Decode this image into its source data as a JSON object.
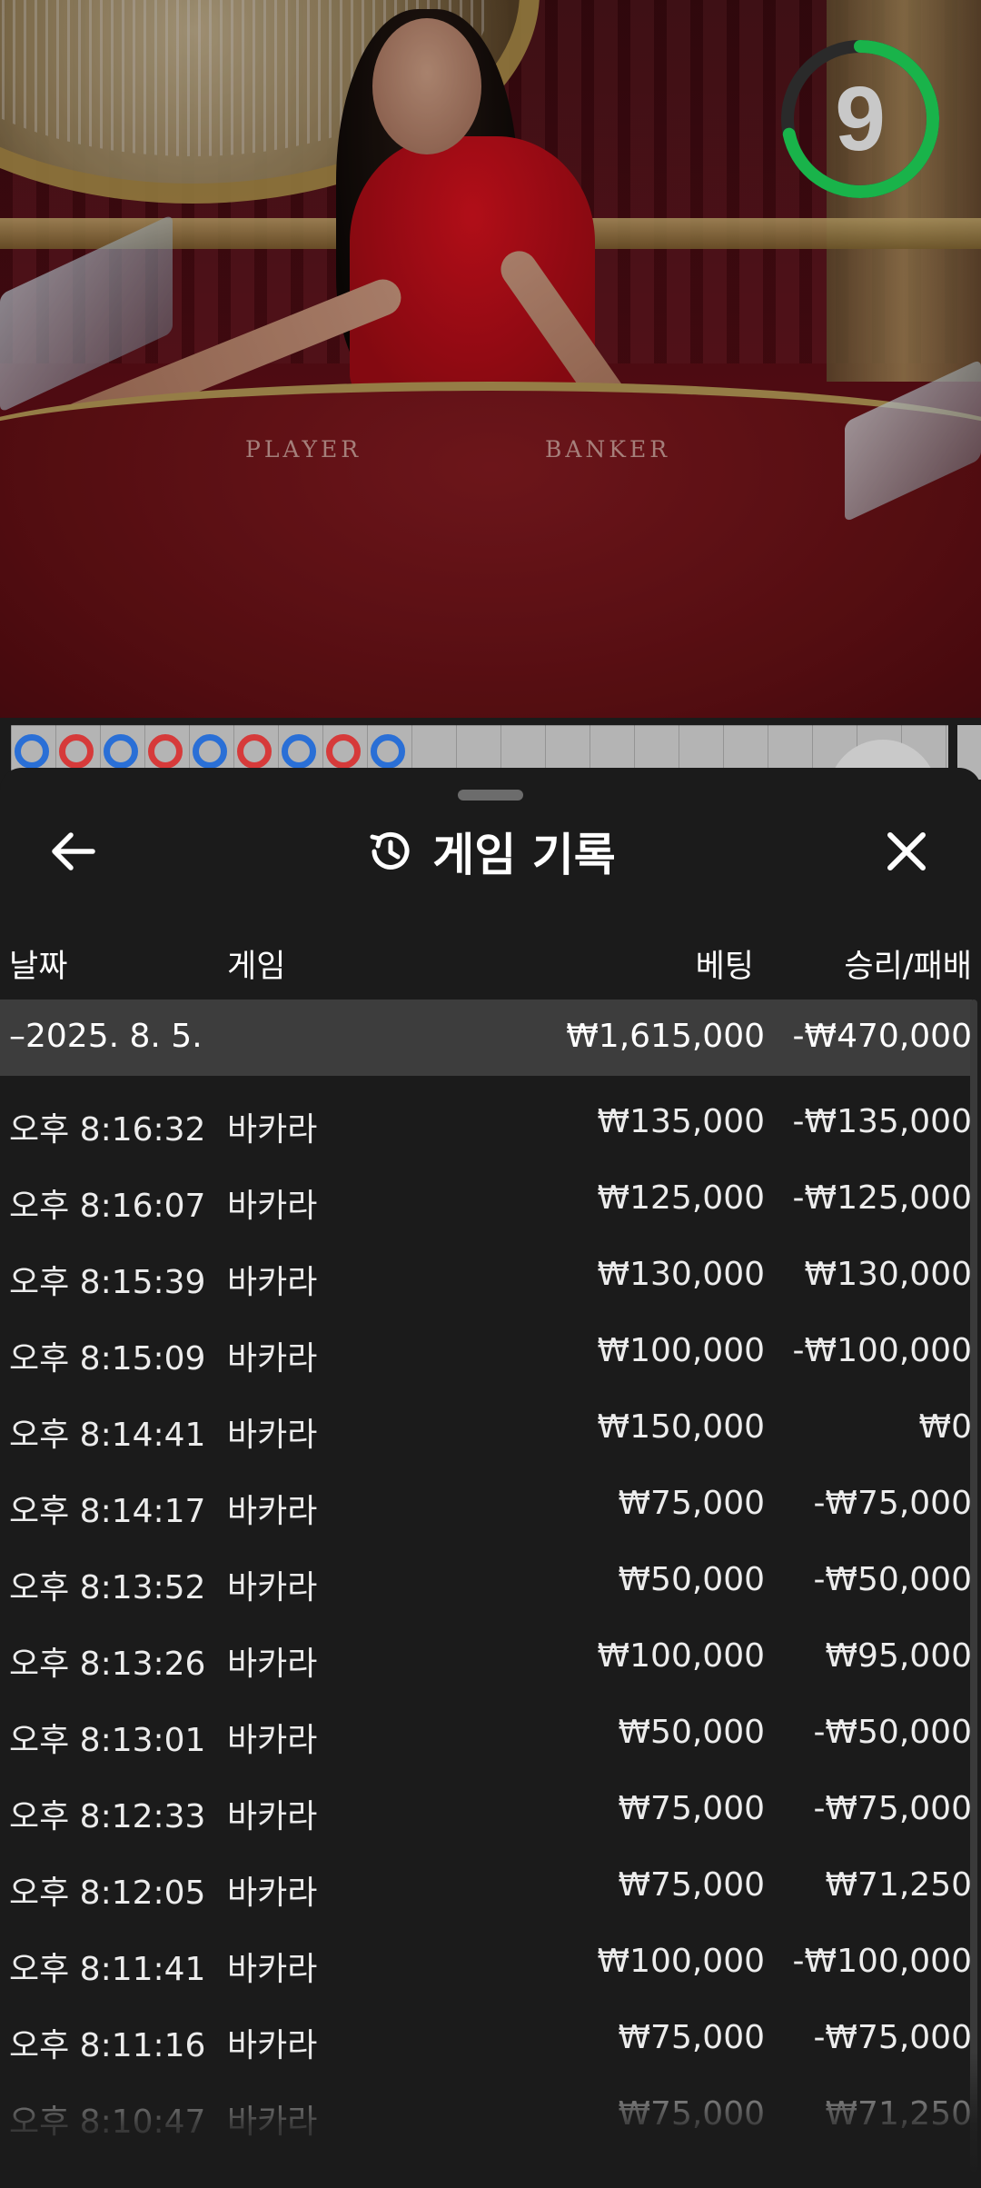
{
  "video": {
    "table_labels": {
      "player": "PLAYER",
      "banker": "BANKER"
    },
    "timer": {
      "value": "9",
      "color": "#19b34a",
      "track_color": "#2a2a2a"
    }
  },
  "scoreboard": {
    "beads": [
      "blue",
      "red",
      "blue",
      "red",
      "blue",
      "red",
      "blue",
      "red",
      "blue"
    ]
  },
  "sheet": {
    "title": "게임 기록",
    "title_icon": "history-icon",
    "back_icon": "arrow-left-icon",
    "close_icon": "close-icon",
    "columns": {
      "date": "날짜",
      "game": "게임",
      "bet": "베팅",
      "win_loss": "승리/패배"
    },
    "summary": {
      "date": "–2025. 8. 5.",
      "bet": "₩1,615,000",
      "win_loss": "-₩470,000"
    },
    "rows": [
      {
        "time": "오후 8:16:32",
        "game": "바카라",
        "bet": "₩135,000",
        "win_loss": "-₩135,000"
      },
      {
        "time": "오후 8:16:07",
        "game": "바카라",
        "bet": "₩125,000",
        "win_loss": "-₩125,000"
      },
      {
        "time": "오후 8:15:39",
        "game": "바카라",
        "bet": "₩130,000",
        "win_loss": "₩130,000"
      },
      {
        "time": "오후 8:15:09",
        "game": "바카라",
        "bet": "₩100,000",
        "win_loss": "-₩100,000"
      },
      {
        "time": "오후 8:14:41",
        "game": "바카라",
        "bet": "₩150,000",
        "win_loss": "₩0"
      },
      {
        "time": "오후 8:14:17",
        "game": "바카라",
        "bet": "₩75,000",
        "win_loss": "-₩75,000"
      },
      {
        "time": "오후 8:13:52",
        "game": "바카라",
        "bet": "₩50,000",
        "win_loss": "-₩50,000"
      },
      {
        "time": "오후 8:13:26",
        "game": "바카라",
        "bet": "₩100,000",
        "win_loss": "₩95,000"
      },
      {
        "time": "오후 8:13:01",
        "game": "바카라",
        "bet": "₩50,000",
        "win_loss": "-₩50,000"
      },
      {
        "time": "오후 8:12:33",
        "game": "바카라",
        "bet": "₩75,000",
        "win_loss": "-₩75,000"
      },
      {
        "time": "오후 8:12:05",
        "game": "바카라",
        "bet": "₩75,000",
        "win_loss": "₩71,250"
      },
      {
        "time": "오후 8:11:41",
        "game": "바카라",
        "bet": "₩100,000",
        "win_loss": "-₩100,000"
      },
      {
        "time": "오후 8:11:16",
        "game": "바카라",
        "bet": "₩75,000",
        "win_loss": "-₩75,000"
      },
      {
        "time": "오후 8:10:47",
        "game": "바카라",
        "bet": "₩75,000",
        "win_loss": "₩71,250"
      }
    ]
  }
}
